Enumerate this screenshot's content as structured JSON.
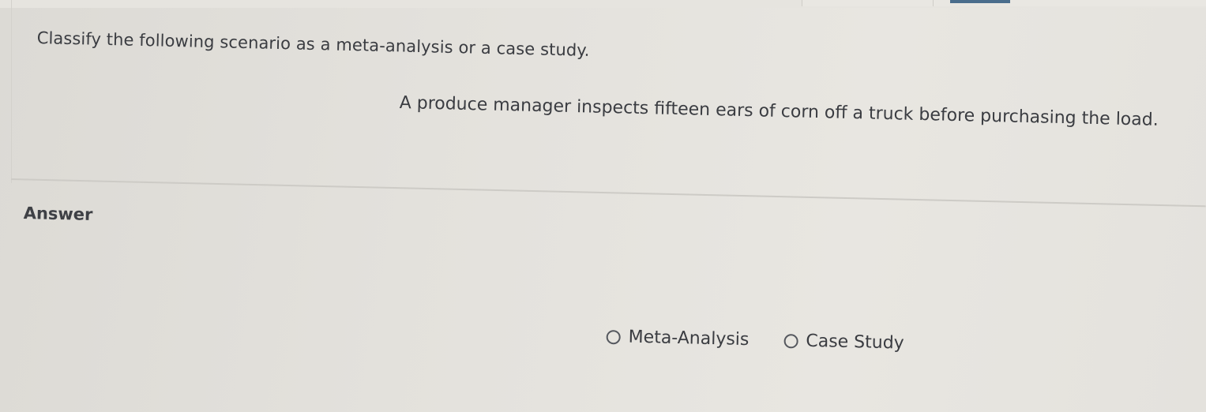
{
  "question": {
    "prompt": "Classify the following scenario as a meta-analysis or a case study.",
    "scenario": "A produce manager inspects fifteen ears of corn off a truck before purchasing the load."
  },
  "answer": {
    "label": "Answer",
    "options": [
      {
        "label": "Meta-Analysis",
        "selected": false
      },
      {
        "label": "Case Study",
        "selected": false
      }
    ]
  },
  "colors": {
    "background": "#e3e1dc",
    "text": "#3a3c41",
    "accent": "#4a6d8c"
  }
}
